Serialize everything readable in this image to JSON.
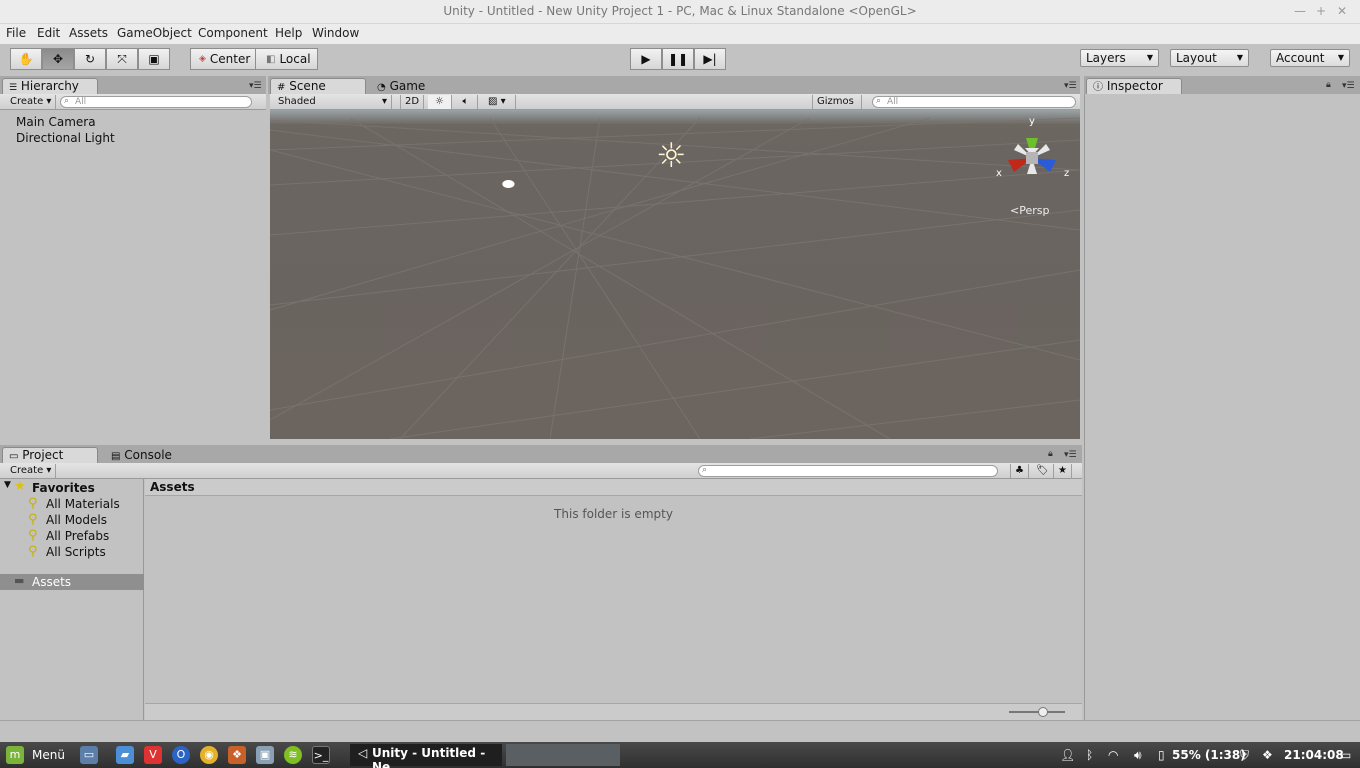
{
  "window": {
    "title": "Unity - Untitled - New Unity Project 1 - PC, Mac & Linux Standalone <OpenGL>"
  },
  "menu": [
    "File",
    "Edit",
    "Assets",
    "GameObject",
    "Component",
    "Help",
    "Window"
  ],
  "toolbar": {
    "pivot_label": "Center",
    "space_label": "Local",
    "layers_label": "Layers",
    "layout_label": "Layout",
    "account_label": "Account"
  },
  "hierarchy": {
    "tab": "Hierarchy",
    "create_label": "Create",
    "search_placeholder": "All",
    "items": [
      "Main Camera",
      "Directional Light"
    ]
  },
  "scene": {
    "tab_scene": "Scene",
    "tab_game": "Game",
    "shading_mode": "Shaded",
    "mode_2d": "2D",
    "gizmos_label": "Gizmos",
    "search_placeholder": "All",
    "axis_x": "x",
    "axis_y": "y",
    "axis_z": "z",
    "projection": "Persp"
  },
  "inspector": {
    "tab": "Inspector"
  },
  "project": {
    "tab_project": "Project",
    "tab_console": "Console",
    "create_label": "Create",
    "favorites_label": "Favorites",
    "favorites": [
      "All Materials",
      "All Models",
      "All Prefabs",
      "All Scripts"
    ],
    "assets_root": "Assets",
    "breadcrumb": "Assets",
    "empty_message": "This folder is empty",
    "zoom_slider": 0.6
  },
  "taskbar": {
    "menu_label": "Menü",
    "active_window": "Unity - Untitled - Ne...",
    "battery": "55% (1:38)",
    "clock": "21:04:08"
  },
  "colors": {
    "scene_ground": "#6b645f",
    "axis_x": "#c0281a",
    "axis_y": "#6cc12a",
    "axis_z": "#2a5bd8",
    "panel_bg": "#c2c2c2"
  }
}
